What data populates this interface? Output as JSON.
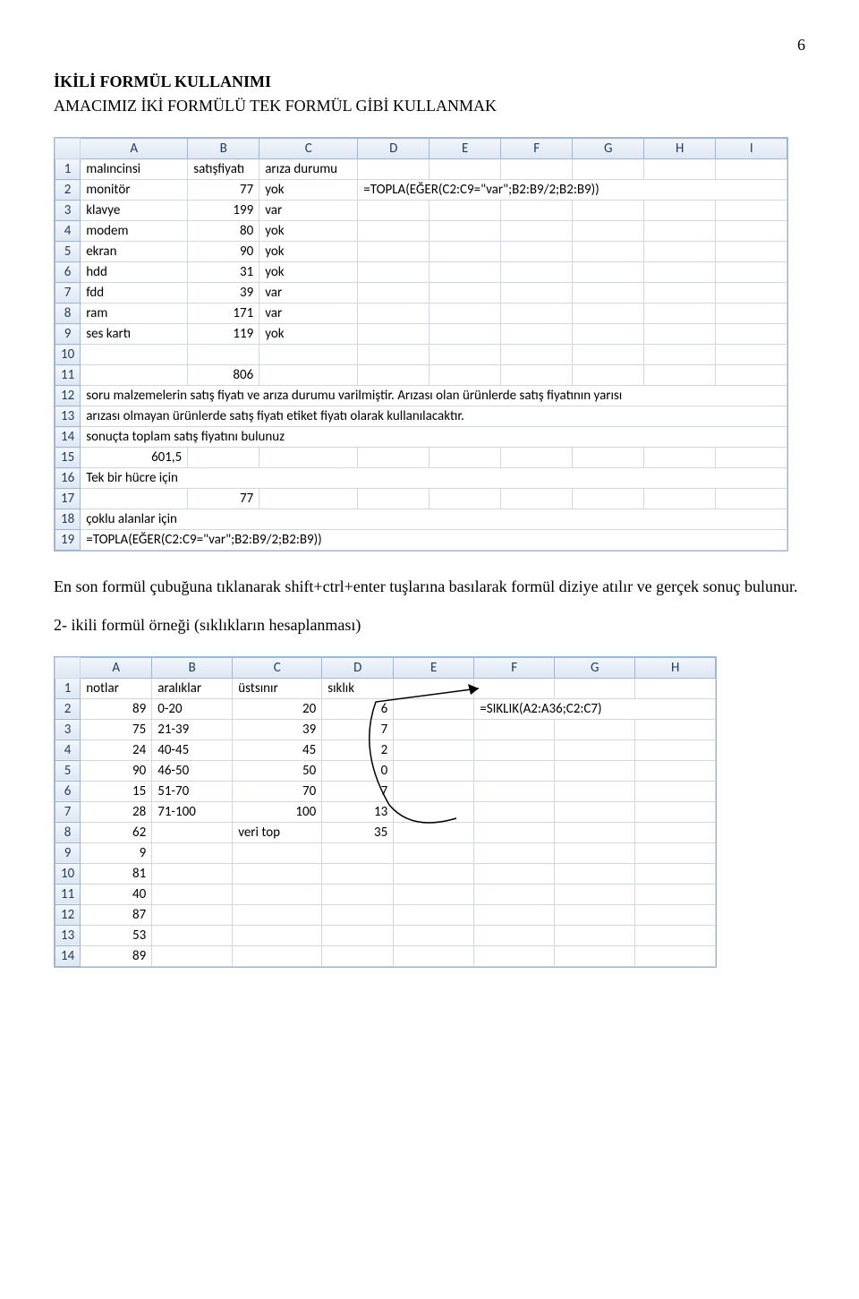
{
  "page_number": "6",
  "title": "İKİLİ FORMÜL KULLANIMI",
  "subtitle": "AMACIMIZ İKİ FORMÜLÜ TEK FORMÜL GİBİ KULLANMAK",
  "paragraph": "En son formül çubuğuna tıklanarak shift+ctrl+enter tuşlarına basılarak formül diziye atılır ve gerçek sonuç bulunur.",
  "example2_title": "2- ikili formül örneği (sıklıkların hesaplanması)",
  "ss1": {
    "cols": [
      "A",
      "B",
      "C",
      "D",
      "E",
      "F",
      "G",
      "H",
      "I"
    ],
    "rows": {
      "1": {
        "A": "malıncinsi",
        "B": "satışfiyatı",
        "C": "arıza durumu"
      },
      "2": {
        "A": "monitör",
        "B": "77",
        "C": "yok",
        "D": "=TOPLA(EĞER(C2:C9=\"var\";B2:B9/2;B2:B9))"
      },
      "3": {
        "A": "klavye",
        "B": "199",
        "C": "var"
      },
      "4": {
        "A": "modem",
        "B": "80",
        "C": "yok"
      },
      "5": {
        "A": "ekran",
        "B": "90",
        "C": "yok"
      },
      "6": {
        "A": "hdd",
        "B": "31",
        "C": "yok"
      },
      "7": {
        "A": "fdd",
        "B": "39",
        "C": "var"
      },
      "8": {
        "A": "ram",
        "B": "171",
        "C": "var"
      },
      "9": {
        "A": "ses kartı",
        "B": "119",
        "C": "yok"
      },
      "10": {},
      "11": {
        "B": "806"
      },
      "12": {
        "A": "soru malzemelerin satış fiyatı ve arıza durumu varilmiştir. Arızası olan ürünlerde satış fiyatının yarısı"
      },
      "13": {
        "A": "arızası olmayan ürünlerde satış fiyatı etiket fiyatı olarak kullanılacaktır."
      },
      "14": {
        "A": "sonuçta toplam satış fiyatını bulunuz"
      },
      "15": {
        "A": "601,5"
      },
      "16": {
        "A": "Tek bir hücre için"
      },
      "17": {
        "B": "77"
      },
      "18": {
        "A": "çoklu alanlar için"
      },
      "19": {
        "A": "=TOPLA(EĞER(C2:C9=\"var\";B2:B9/2;B2:B9))"
      }
    }
  },
  "ss2": {
    "cols": [
      "A",
      "B",
      "C",
      "D",
      "E",
      "F",
      "G",
      "H"
    ],
    "rows": {
      "1": {
        "A": "notlar",
        "B": "aralıklar",
        "C": "üstsınır",
        "D": "sıklık"
      },
      "2": {
        "A": "89",
        "B": "0-20",
        "C": "20",
        "D": "6",
        "F": "=SIKLIK(A2:A36;C2:C7)"
      },
      "3": {
        "A": "75",
        "B": "21-39",
        "C": "39",
        "D": "7"
      },
      "4": {
        "A": "24",
        "B": "40-45",
        "C": "45",
        "D": "2"
      },
      "5": {
        "A": "90",
        "B": "46-50",
        "C": "50",
        "D": "0"
      },
      "6": {
        "A": "15",
        "B": "51-70",
        "C": "70",
        "D": "7"
      },
      "7": {
        "A": "28",
        "B": "71-100",
        "C": "100",
        "D": "13"
      },
      "8": {
        "A": "62",
        "C": "veri top",
        "D": "35"
      },
      "9": {
        "A": "9"
      },
      "10": {
        "A": "81"
      },
      "11": {
        "A": "40"
      },
      "12": {
        "A": "87"
      },
      "13": {
        "A": "53"
      },
      "14": {
        "A": "89"
      }
    }
  }
}
